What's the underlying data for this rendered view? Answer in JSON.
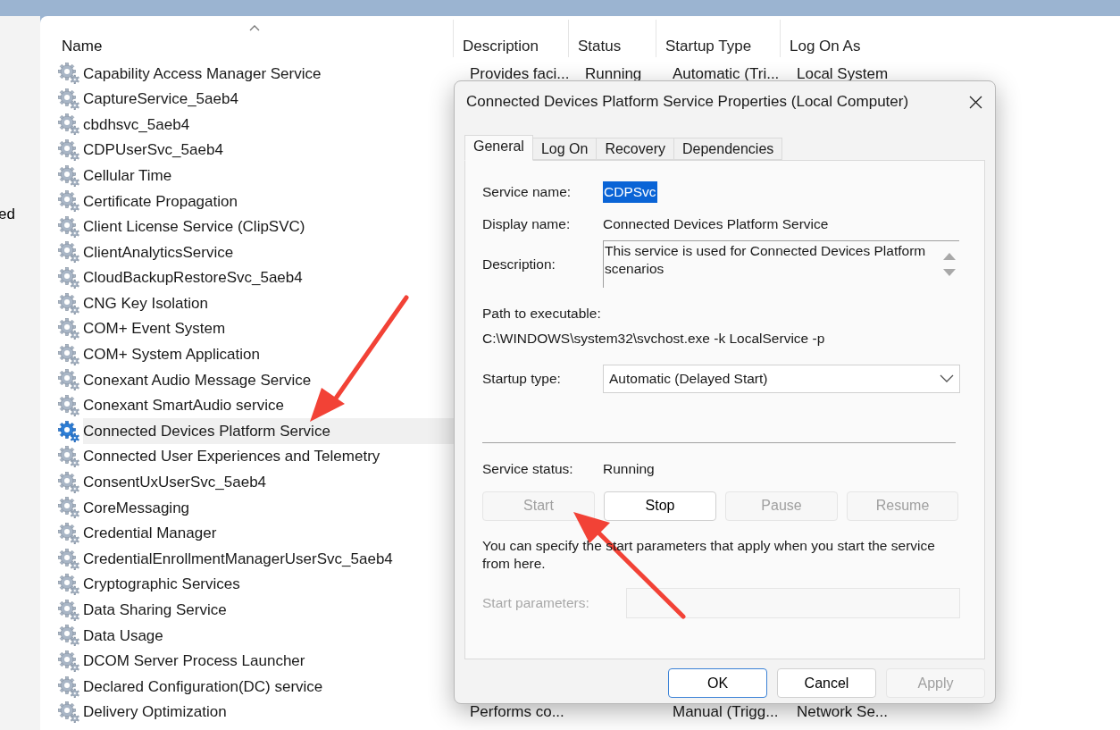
{
  "left_pane": {
    "text": "ed"
  },
  "table": {
    "columns": [
      {
        "label": "Name",
        "sorted": true
      },
      {
        "label": "Description",
        "sorted": false
      },
      {
        "label": "Status",
        "sorted": false
      },
      {
        "label": "Startup Type",
        "sorted": false
      },
      {
        "label": "Log On As",
        "sorted": false
      }
    ],
    "rows": [
      {
        "name": "Capability Access Manager Service",
        "description": "Provides faci...",
        "status": "Running",
        "startup_type": "Automatic (Tri...",
        "log_on_as": "Local System",
        "selected": false
      },
      {
        "name": "CaptureService_5aeb4",
        "selected": false
      },
      {
        "name": "cbdhsvc_5aeb4",
        "selected": false
      },
      {
        "name": "CDPUserSvc_5aeb4",
        "selected": false
      },
      {
        "name": "Cellular Time",
        "selected": false
      },
      {
        "name": "Certificate Propagation",
        "selected": false
      },
      {
        "name": "Client License Service (ClipSVC)",
        "selected": false
      },
      {
        "name": "ClientAnalyticsService",
        "selected": false
      },
      {
        "name": "CloudBackupRestoreSvc_5aeb4",
        "selected": false
      },
      {
        "name": "CNG Key Isolation",
        "selected": false
      },
      {
        "name": "COM+ Event System",
        "selected": false
      },
      {
        "name": "COM+ System Application",
        "selected": false
      },
      {
        "name": "Conexant Audio Message Service",
        "selected": false
      },
      {
        "name": "Conexant SmartAudio service",
        "selected": false
      },
      {
        "name": "Connected Devices Platform Service",
        "selected": true
      },
      {
        "name": "Connected User Experiences and Telemetry",
        "selected": false
      },
      {
        "name": "ConsentUxUserSvc_5aeb4",
        "selected": false
      },
      {
        "name": "CoreMessaging",
        "selected": false
      },
      {
        "name": "Credential Manager",
        "selected": false
      },
      {
        "name": "CredentialEnrollmentManagerUserSvc_5aeb4",
        "selected": false
      },
      {
        "name": "Cryptographic Services",
        "selected": false
      },
      {
        "name": "Data Sharing Service",
        "selected": false
      },
      {
        "name": "Data Usage",
        "selected": false
      },
      {
        "name": "DCOM Server Process Launcher",
        "selected": false
      },
      {
        "name": "Declared Configuration(DC) service",
        "selected": false
      },
      {
        "name": "Delivery Optimization",
        "description": "Performs co...",
        "startup_type": "Manual (Trigg...",
        "log_on_as": "Network Se...",
        "selected": false
      }
    ]
  },
  "dialog": {
    "title": "Connected Devices Platform Service Properties (Local Computer)",
    "tabs": [
      {
        "label": "General",
        "selected": true
      },
      {
        "label": "Log On",
        "selected": false
      },
      {
        "label": "Recovery",
        "selected": false
      },
      {
        "label": "Dependencies",
        "selected": false
      }
    ],
    "service_name": {
      "label": "Service name:",
      "value": "CDPSvc",
      "highlighted": true
    },
    "display_name": {
      "label": "Display name:",
      "value": "Connected Devices Platform Service"
    },
    "description": {
      "label": "Description:",
      "value": "This service is used for Connected Devices Platform scenarios"
    },
    "path": {
      "label": "Path to executable:",
      "value": "C:\\WINDOWS\\system32\\svchost.exe -k LocalService -p"
    },
    "startup_type": {
      "label": "Startup type:",
      "value": "Automatic (Delayed Start)"
    },
    "service_status": {
      "label": "Service status:",
      "value": "Running"
    },
    "control_buttons": [
      {
        "label": "Start",
        "disabled": true
      },
      {
        "label": "Stop",
        "disabled": false
      },
      {
        "label": "Pause",
        "disabled": true
      },
      {
        "label": "Resume",
        "disabled": true
      }
    ],
    "hint": "You can specify the start parameters that apply when you start the service from here.",
    "start_parameters": {
      "label": "Start parameters:",
      "disabled": true
    },
    "buttons": [
      {
        "label": "OK",
        "default": true,
        "disabled": false
      },
      {
        "label": "Cancel",
        "default": false,
        "disabled": false
      },
      {
        "label": "Apply",
        "default": false,
        "disabled": true
      }
    ]
  }
}
